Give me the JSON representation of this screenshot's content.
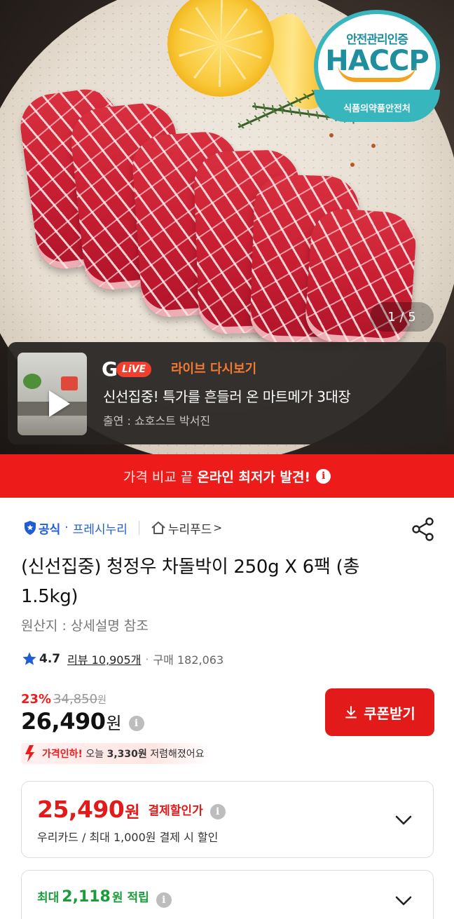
{
  "gallery": {
    "badge": {
      "top": "안전관리인증",
      "main": "HACCP",
      "bottom": "식품의약품안전처"
    },
    "counter": "1 / 5"
  },
  "live": {
    "logo_letter": "G",
    "logo_pill": "LiVE",
    "tag": "라이브 다시보기",
    "title": "신선집중! 특가를 흔들러 온 마트메가 3대장",
    "host": "출연 : 쇼호스트 박서진"
  },
  "banner": {
    "lead": "가격 비교 끝",
    "emphasis": "온라인 최저가 발견!",
    "info_glyph": "i"
  },
  "seller": {
    "official": "공식",
    "separator": "·",
    "name": "프레시누리",
    "brand": "누리푸드",
    "brand_chevron": ">"
  },
  "product": {
    "title": "(신선집중) 청정우 차돌박이 250g X 6팩 (총 1.5kg)",
    "origin": "원산지 : 상세설명 참조",
    "rating": "4.7",
    "reviews": "리뷰 10,905개",
    "purchase_sep": "·",
    "purchases": "구매 182,063"
  },
  "price": {
    "discount": "23%",
    "original": "34,850",
    "original_unit": "원",
    "current": "26,490",
    "unit": "원",
    "info_glyph": "i",
    "coupon_button": "쿠폰받기",
    "drop_prefix": "가격인하!",
    "drop_mid": " 오늘 ",
    "drop_amount": "3,330원",
    "drop_suffix": " 저렴해졌어요"
  },
  "payment_card": {
    "price": "25,490",
    "unit": "원",
    "label": "결제할인가",
    "info_glyph": "i",
    "sub": "우리카드 / 최대 1,000원 결제 시 할인"
  },
  "points_card": {
    "prefix": "최대",
    "amount": "2,118",
    "unit": "원",
    "suffix": "적립",
    "info_glyph": "i"
  },
  "colors": {
    "accent_red": "#ee1b1b",
    "coupon_red": "#e31a1a",
    "official_blue": "#1f5dd8",
    "points_green": "#1c9b3a",
    "live_orange": "#f47a31"
  },
  "icons": [
    "shield-icon",
    "home-icon",
    "share-icon",
    "star-icon",
    "download-icon",
    "arrow-down-icon",
    "chevron-down-icon",
    "play-icon",
    "info-icon"
  ]
}
